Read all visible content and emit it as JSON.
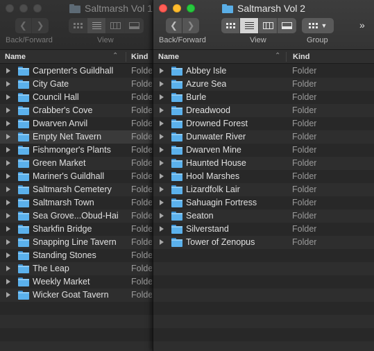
{
  "window_left": {
    "title": "Saltmarsh Vol 1",
    "toolbar": {
      "back_forward_label": "Back/Forward",
      "view_label": "View"
    },
    "columns": {
      "name": "Name",
      "kind": "Kind"
    },
    "items": [
      {
        "name": "Carpenter's Guildhall",
        "kind": "Folder"
      },
      {
        "name": "City Gate",
        "kind": "Folder"
      },
      {
        "name": "Council Hall",
        "kind": "Folder"
      },
      {
        "name": "Crabber's Cove",
        "kind": "Folder"
      },
      {
        "name": "Dwarven Anvil",
        "kind": "Folder"
      },
      {
        "name": "Empty Net Tavern",
        "kind": "Folder"
      },
      {
        "name": "Fishmonger's Plants",
        "kind": "Folder"
      },
      {
        "name": "Green Market",
        "kind": "Folder"
      },
      {
        "name": "Mariner's Guildhall",
        "kind": "Folder"
      },
      {
        "name": "Saltmarsh Cemetery",
        "kind": "Folder"
      },
      {
        "name": "Saltmarsh Town",
        "kind": "Folder"
      },
      {
        "name": "Sea Grove...Obud-Hai",
        "kind": "Folder"
      },
      {
        "name": "Sharkfin Bridge",
        "kind": "Folder"
      },
      {
        "name": "Snapping Line Tavern",
        "kind": "Folder"
      },
      {
        "name": "Standing Stones",
        "kind": "Folder"
      },
      {
        "name": "The Leap",
        "kind": "Folder"
      },
      {
        "name": "Weekly Market",
        "kind": "Folder"
      },
      {
        "name": "Wicker Goat Tavern",
        "kind": "Folder"
      }
    ]
  },
  "window_right": {
    "title": "Saltmarsh Vol 2",
    "toolbar": {
      "back_forward_label": "Back/Forward",
      "view_label": "View",
      "group_label": "Group",
      "overflow_glyph": "»"
    },
    "columns": {
      "name": "Name",
      "kind": "Kind"
    },
    "items": [
      {
        "name": "Abbey Isle",
        "kind": "Folder"
      },
      {
        "name": "Azure Sea",
        "kind": "Folder"
      },
      {
        "name": "Burle",
        "kind": "Folder"
      },
      {
        "name": "Dreadwood",
        "kind": "Folder"
      },
      {
        "name": "Drowned Forest",
        "kind": "Folder"
      },
      {
        "name": "Dunwater River",
        "kind": "Folder"
      },
      {
        "name": "Dwarven Mine",
        "kind": "Folder"
      },
      {
        "name": "Haunted House",
        "kind": "Folder"
      },
      {
        "name": "Hool Marshes",
        "kind": "Folder"
      },
      {
        "name": "Lizardfolk Lair",
        "kind": "Folder"
      },
      {
        "name": "Sahuagin Fortress",
        "kind": "Folder"
      },
      {
        "name": "Seaton",
        "kind": "Folder"
      },
      {
        "name": "Silverstand",
        "kind": "Folder"
      },
      {
        "name": "Tower of Zenopus",
        "kind": "Folder"
      }
    ]
  },
  "colors": {
    "folder": "#5bb1ec",
    "close": "#ff5f57",
    "minimize": "#febc2e",
    "zoom": "#28c840"
  }
}
